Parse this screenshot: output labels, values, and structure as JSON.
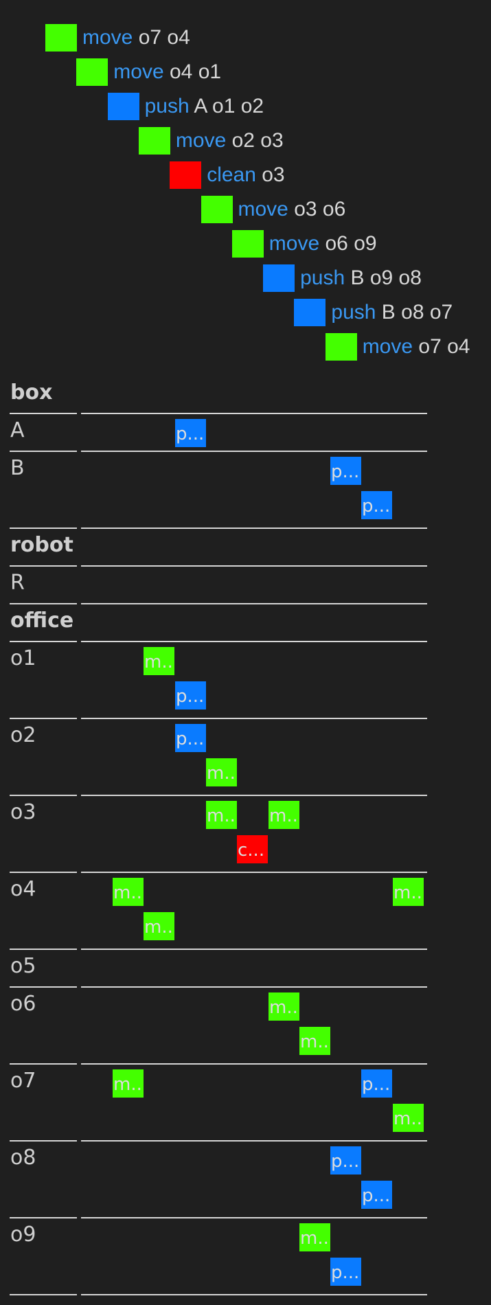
{
  "colors": {
    "move": "#44ff00",
    "push": "#0a7bff",
    "clean": "#ff0000",
    "action_text": "#3a98f2",
    "args_text": "#d8d8d8",
    "background": "#1f1f1f"
  },
  "plan": [
    {
      "action": "move",
      "args": "o7 o4",
      "type": "move"
    },
    {
      "action": "move",
      "args": "o4 o1",
      "type": "move"
    },
    {
      "action": "push",
      "args": "A o1 o2",
      "type": "push"
    },
    {
      "action": "move",
      "args": "o2 o3",
      "type": "move"
    },
    {
      "action": "clean",
      "args": "o3",
      "type": "clean"
    },
    {
      "action": "move",
      "args": "o3 o6",
      "type": "move"
    },
    {
      "action": "move",
      "args": "o6 o9",
      "type": "move"
    },
    {
      "action": "push",
      "args": "B o9 o8",
      "type": "push"
    },
    {
      "action": "push",
      "args": "B o8 o7",
      "type": "push"
    },
    {
      "action": "move",
      "args": "o7 o4",
      "type": "move"
    }
  ],
  "timeline": {
    "rows": [
      {
        "kind": "group",
        "label": "box"
      },
      {
        "kind": "object",
        "label": "A",
        "lanes": [
          [
            {
              "step": 3,
              "type": "push",
              "text": "p..."
            }
          ]
        ]
      },
      {
        "kind": "object",
        "label": "B",
        "lanes": [
          [
            {
              "step": 8,
              "type": "push",
              "text": "p..."
            }
          ],
          [
            {
              "step": 9,
              "type": "push",
              "text": "p..."
            }
          ]
        ]
      },
      {
        "kind": "group",
        "label": "robot"
      },
      {
        "kind": "object",
        "label": "R",
        "lanes": [
          []
        ]
      },
      {
        "kind": "group",
        "label": "office"
      },
      {
        "kind": "object",
        "label": "o1",
        "lanes": [
          [
            {
              "step": 2,
              "type": "move",
              "text": "m.."
            }
          ],
          [
            {
              "step": 3,
              "type": "push",
              "text": "p..."
            }
          ]
        ]
      },
      {
        "kind": "object",
        "label": "o2",
        "lanes": [
          [
            {
              "step": 3,
              "type": "push",
              "text": "p..."
            }
          ],
          [
            {
              "step": 4,
              "type": "move",
              "text": "m.."
            }
          ]
        ]
      },
      {
        "kind": "object",
        "label": "o3",
        "lanes": [
          [
            {
              "step": 4,
              "type": "move",
              "text": "m.."
            },
            {
              "step": 6,
              "type": "move",
              "text": "m.."
            }
          ],
          [
            {
              "step": 5,
              "type": "clean",
              "text": "c..."
            }
          ]
        ]
      },
      {
        "kind": "object",
        "label": "o4",
        "lanes": [
          [
            {
              "step": 1,
              "type": "move",
              "text": "m.."
            },
            {
              "step": 10,
              "type": "move",
              "text": "m.."
            }
          ],
          [
            {
              "step": 2,
              "type": "move",
              "text": "m.."
            }
          ]
        ]
      },
      {
        "kind": "object",
        "label": "o5",
        "lanes": [
          []
        ]
      },
      {
        "kind": "object",
        "label": "o6",
        "lanes": [
          [
            {
              "step": 6,
              "type": "move",
              "text": "m.."
            }
          ],
          [
            {
              "step": 7,
              "type": "move",
              "text": "m.."
            }
          ]
        ]
      },
      {
        "kind": "object",
        "label": "o7",
        "lanes": [
          [
            {
              "step": 1,
              "type": "move",
              "text": "m.."
            },
            {
              "step": 9,
              "type": "push",
              "text": "p..."
            }
          ],
          [
            {
              "step": 10,
              "type": "move",
              "text": "m.."
            }
          ]
        ]
      },
      {
        "kind": "object",
        "label": "o8",
        "lanes": [
          [
            {
              "step": 8,
              "type": "push",
              "text": "p..."
            }
          ],
          [
            {
              "step": 9,
              "type": "push",
              "text": "p..."
            }
          ]
        ]
      },
      {
        "kind": "object",
        "label": "o9",
        "lanes": [
          [
            {
              "step": 7,
              "type": "move",
              "text": "m.."
            }
          ],
          [
            {
              "step": 8,
              "type": "push",
              "text": "p..."
            }
          ]
        ]
      }
    ]
  }
}
